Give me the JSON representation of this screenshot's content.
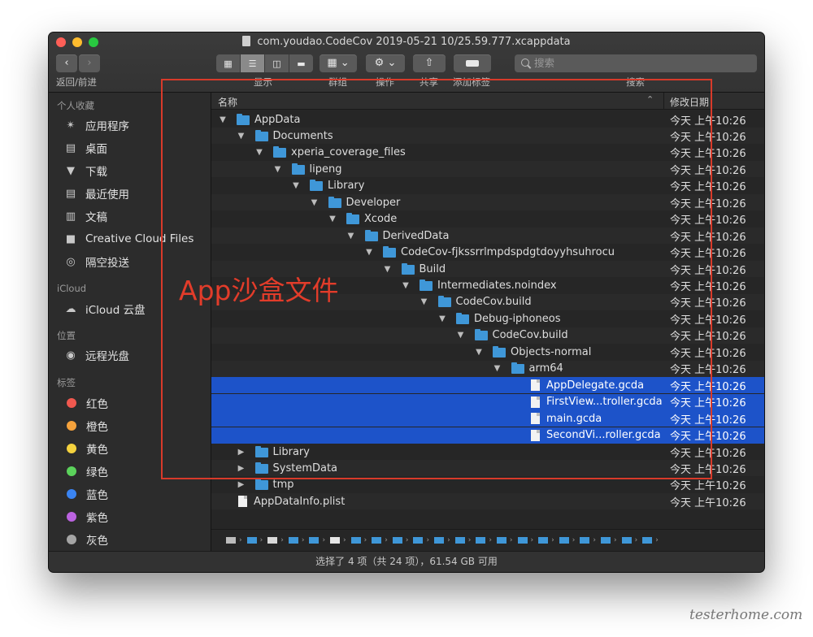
{
  "window": {
    "title": "com.youdao.CodeCov 2019-05-21 10/25.59.777.xcappdata"
  },
  "toolbar": {
    "nav_label": "返回/前进",
    "view_label": "显示",
    "group_label": "群组",
    "action_label": "操作",
    "share_label": "共享",
    "tag_label": "添加标签",
    "search_label": "搜索",
    "search_placeholder": "搜索"
  },
  "sidebar": {
    "favorites_header": "个人收藏",
    "favorites": [
      {
        "label": "应用程序",
        "icon": "applications-icon"
      },
      {
        "label": "桌面",
        "icon": "desktop-icon"
      },
      {
        "label": "下载",
        "icon": "downloads-icon"
      },
      {
        "label": "最近使用",
        "icon": "recents-icon"
      },
      {
        "label": "文稿",
        "icon": "documents-icon"
      },
      {
        "label": "Creative Cloud Files",
        "icon": "folder-icon"
      },
      {
        "label": "隔空投送",
        "icon": "airdrop-icon"
      }
    ],
    "icloud_header": "iCloud",
    "icloud": [
      {
        "label": "iCloud 云盘",
        "icon": "cloud-icon"
      }
    ],
    "locations_header": "位置",
    "locations": [
      {
        "label": "远程光盘",
        "icon": "disc-icon"
      }
    ],
    "tags_header": "标签",
    "tags": [
      {
        "label": "红色",
        "color": "#f0584f"
      },
      {
        "label": "橙色",
        "color": "#f5a23c"
      },
      {
        "label": "黄色",
        "color": "#f4d23e"
      },
      {
        "label": "绿色",
        "color": "#5bd25b"
      },
      {
        "label": "蓝色",
        "color": "#3a84f2"
      },
      {
        "label": "紫色",
        "color": "#bb63e0"
      },
      {
        "label": "灰色",
        "color": "#a5a5a5"
      }
    ]
  },
  "list": {
    "col_name": "名称",
    "col_date": "修改日期",
    "rows": [
      {
        "name": "AppData",
        "date": "今天 上午10:26"
      },
      {
        "name": "Documents",
        "date": "今天 上午10:26"
      },
      {
        "name": "xperia_coverage_files",
        "date": "今天 上午10:26"
      },
      {
        "name": "lipeng",
        "date": "今天 上午10:26"
      },
      {
        "name": "Library",
        "date": "今天 上午10:26"
      },
      {
        "name": "Developer",
        "date": "今天 上午10:26"
      },
      {
        "name": "Xcode",
        "date": "今天 上午10:26"
      },
      {
        "name": "DerivedData",
        "date": "今天 上午10:26"
      },
      {
        "name": "CodeCov-fjkssrrlmpdspdgtdoyyhsuhrocu",
        "date": "今天 上午10:26"
      },
      {
        "name": "Build",
        "date": "今天 上午10:26"
      },
      {
        "name": "Intermediates.noindex",
        "date": "今天 上午10:26"
      },
      {
        "name": "CodeCov.build",
        "date": "今天 上午10:26"
      },
      {
        "name": "Debug-iphoneos",
        "date": "今天 上午10:26"
      },
      {
        "name": "CodeCov.build",
        "date": "今天 上午10:26"
      },
      {
        "name": "Objects-normal",
        "date": "今天 上午10:26"
      },
      {
        "name": "arm64",
        "date": "今天 上午10:26"
      },
      {
        "name": "AppDelegate.gcda",
        "date": "今天 上午10:26"
      },
      {
        "name": "FirstView...troller.gcda",
        "date": "今天 上午10:26"
      },
      {
        "name": "main.gcda",
        "date": "今天 上午10:26"
      },
      {
        "name": "SecondVi...roller.gcda",
        "date": "今天 上午10:26"
      },
      {
        "name": "Library",
        "date": "今天 上午10:26"
      },
      {
        "name": "SystemData",
        "date": "今天 上午10:26"
      },
      {
        "name": "tmp",
        "date": "今天 上午10:26"
      },
      {
        "name": "AppDataInfo.plist",
        "date": "今天 上午10:26"
      }
    ]
  },
  "annotation": {
    "text": "App沙盒文件",
    "color": "#e23c2a"
  },
  "status_bar": {
    "text": "选择了 4 项（共 24 项），61.54 GB 可用"
  },
  "watermark": "testerhome.com",
  "colors": {
    "selection": "#1d53c9",
    "folder": "#3f97d8"
  }
}
